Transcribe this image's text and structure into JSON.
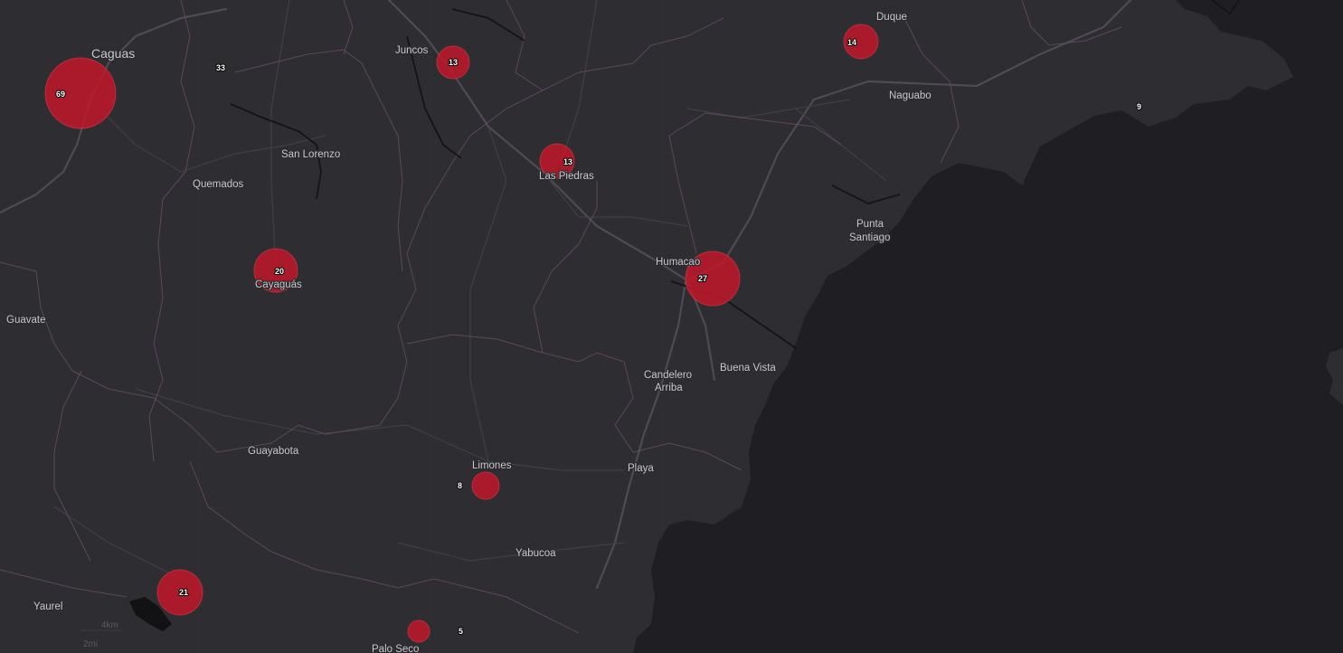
{
  "map": {
    "colors": {
      "land": "#2e2d31",
      "water": "#1f1e23",
      "bubble": "#c0182a",
      "boundary": "#6c5070",
      "road": "#4c4c52",
      "label": "#c8c8cc"
    },
    "places": [
      {
        "name": "Caguas"
      },
      {
        "name": "Juncos"
      },
      {
        "name": "Duque"
      },
      {
        "name": "Naguabo"
      },
      {
        "name": "San Lorenzo"
      },
      {
        "name": "Quemados"
      },
      {
        "name": "Las Piedras"
      },
      {
        "name": "Punta"
      },
      {
        "name": "Santiago"
      },
      {
        "name": "Humacao"
      },
      {
        "name": "Cayaguás"
      },
      {
        "name": "Guavate"
      },
      {
        "name": "Candelero"
      },
      {
        "name": "Arriba"
      },
      {
        "name": "Buena Vista"
      },
      {
        "name": "Guayabota"
      },
      {
        "name": "Limones"
      },
      {
        "name": "Playa"
      },
      {
        "name": "Yabucoa"
      },
      {
        "name": "Yaurel"
      },
      {
        "name": "Palo Seco"
      }
    ],
    "markers": [
      {
        "count": "69",
        "bubble": true
      },
      {
        "count": "33",
        "bubble": false
      },
      {
        "count": "13",
        "bubble": true
      },
      {
        "count": "14",
        "bubble": true
      },
      {
        "count": "9",
        "bubble": false
      },
      {
        "count": "13",
        "bubble": true
      },
      {
        "count": "20",
        "bubble": true
      },
      {
        "count": "27",
        "bubble": true
      },
      {
        "count": "8",
        "bubble": false
      },
      {
        "count": "",
        "bubble": true
      },
      {
        "count": "21",
        "bubble": true
      },
      {
        "count": "",
        "bubble": true
      },
      {
        "count": "5",
        "bubble": false
      }
    ],
    "scale": {
      "km": "4km",
      "mi": "2mi"
    }
  }
}
